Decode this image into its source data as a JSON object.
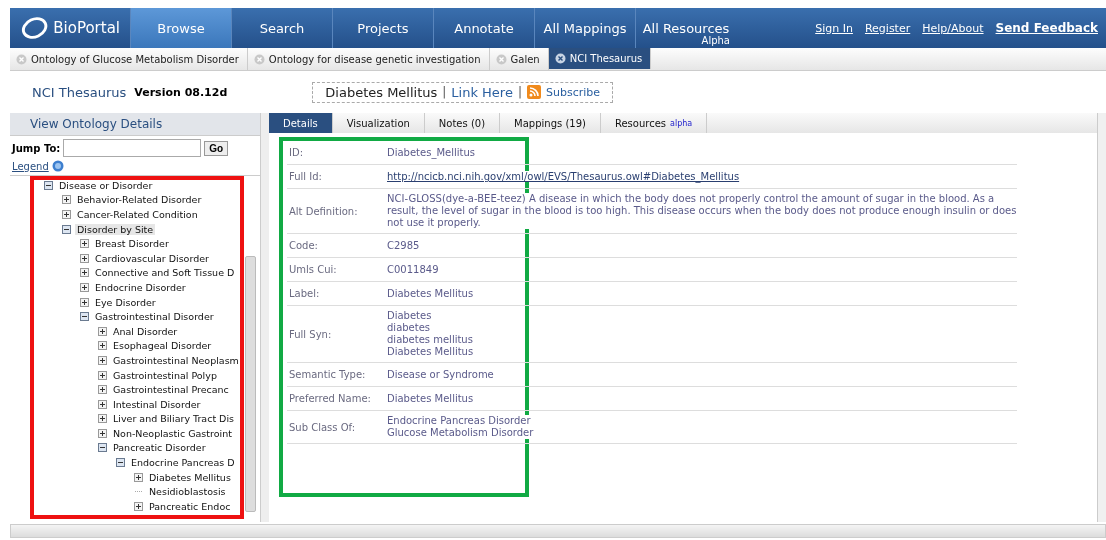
{
  "nav": {
    "logo": "BioPortal",
    "items": [
      {
        "label": "Browse",
        "selected": true
      },
      {
        "label": "Search",
        "selected": false
      },
      {
        "label": "Projects",
        "selected": false
      },
      {
        "label": "Annotate",
        "selected": false
      },
      {
        "label": "All Mappings",
        "selected": false
      },
      {
        "label": "All Resources",
        "sub": "Alpha",
        "selected": false
      }
    ],
    "links": [
      {
        "label": "Sign In",
        "bold": false
      },
      {
        "label": "Register",
        "bold": false
      },
      {
        "label": "Help/About",
        "bold": false
      },
      {
        "label": "Send Feedback",
        "bold": true
      }
    ]
  },
  "ontology_tabs": [
    {
      "label": "Ontology of Glucose Metabolism Disorder",
      "selected": false
    },
    {
      "label": "Ontology for disease genetic investigation",
      "selected": false
    },
    {
      "label": "Galen",
      "selected": false
    },
    {
      "label": "NCI Thesaurus",
      "selected": true
    }
  ],
  "header": {
    "ontology": "NCI Thesaurus",
    "version": "Version 08.12d",
    "term": "Diabetes Mellitus",
    "separator_1": "|",
    "link": "Link Here",
    "separator_2": "|",
    "subscribe": "Subscribe"
  },
  "sidebar": {
    "title": "View Ontology Details",
    "jump_label": "Jump To:",
    "go": "Go",
    "legend": "Legend",
    "tree": [
      {
        "label": "Disease or Disorder",
        "kind": "folder",
        "expanded": true,
        "selected": false,
        "children": [
          {
            "label": "Behavior-Related Disorder",
            "kind": "folder",
            "expanded": false,
            "selected": false
          },
          {
            "label": "Cancer-Related Condition",
            "kind": "folder",
            "expanded": false,
            "selected": false
          },
          {
            "label": "Disorder by Site",
            "kind": "folder",
            "expanded": true,
            "selected": true,
            "children": [
              {
                "label": "Breast Disorder",
                "kind": "folder",
                "expanded": false,
                "selected": false
              },
              {
                "label": "Cardiovascular Disorder",
                "kind": "folder",
                "expanded": false,
                "selected": false
              },
              {
                "label": "Connective and Soft Tissue D",
                "kind": "folder",
                "expanded": false,
                "selected": false
              },
              {
                "label": "Endocrine Disorder",
                "kind": "folder",
                "expanded": false,
                "selected": false
              },
              {
                "label": "Eye Disorder",
                "kind": "folder",
                "expanded": false,
                "selected": false
              },
              {
                "label": "Gastrointestinal Disorder",
                "kind": "folder",
                "expanded": true,
                "selected": false,
                "children": [
                  {
                    "label": "Anal Disorder",
                    "kind": "folder",
                    "expanded": false,
                    "selected": false
                  },
                  {
                    "label": "Esophageal Disorder",
                    "kind": "folder",
                    "expanded": false,
                    "selected": false
                  },
                  {
                    "label": "Gastrointestinal Neoplasm",
                    "kind": "folder",
                    "expanded": false,
                    "selected": false
                  },
                  {
                    "label": "Gastrointestinal Polyp",
                    "kind": "folder",
                    "expanded": false,
                    "selected": false
                  },
                  {
                    "label": "Gastrointestinal Precanc",
                    "kind": "folder",
                    "expanded": false,
                    "selected": false
                  },
                  {
                    "label": "Intestinal Disorder",
                    "kind": "folder",
                    "expanded": false,
                    "selected": false
                  },
                  {
                    "label": "Liver and Biliary Tract Dis",
                    "kind": "folder",
                    "expanded": false,
                    "selected": false
                  },
                  {
                    "label": "Non-Neoplastic Gastroint",
                    "kind": "folder",
                    "expanded": false,
                    "selected": false
                  },
                  {
                    "label": "Pancreatic Disorder",
                    "kind": "folder",
                    "expanded": true,
                    "selected": false,
                    "children": [
                      {
                        "label": "Endocrine Pancreas D",
                        "kind": "folder",
                        "expanded": true,
                        "selected": false,
                        "children": [
                          {
                            "label": "Diabetes Mellitus",
                            "kind": "folder",
                            "expanded": false,
                            "selected": false
                          },
                          {
                            "label": "Nesidioblastosis",
                            "kind": "leaf",
                            "selected": false
                          },
                          {
                            "label": "Pancreatic Endoc",
                            "kind": "folder",
                            "expanded": false,
                            "selected": false
                          }
                        ]
                      }
                    ]
                  }
                ]
              }
            ]
          }
        ]
      }
    ]
  },
  "detail_tabs": [
    {
      "label": "Details",
      "selected": true
    },
    {
      "label": "Visualization",
      "selected": false
    },
    {
      "label": "Notes (0)",
      "selected": false
    },
    {
      "label": "Mappings (19)",
      "selected": false
    },
    {
      "label": "Resources",
      "badge": "alpha",
      "selected": false
    }
  ],
  "details": [
    {
      "label": "ID:",
      "kind": "text",
      "values": [
        "Diabetes_Mellitus"
      ]
    },
    {
      "label": "Full Id:",
      "kind": "link",
      "values": [
        "http://ncicb.nci.nih.gov/xml/owl/EVS/Thesaurus.owl#Diabetes_Mellitus"
      ]
    },
    {
      "label": "Alt Definition:",
      "kind": "text",
      "values": [
        "NCI-GLOSS(dye-a-BEE-teez) A disease in which the body does not properly control the amount of sugar in the blood. As a result, the level of sugar in the blood is too high. This disease occurs when the body does not produce enough insulin or does not use it properly."
      ]
    },
    {
      "label": "Code:",
      "kind": "text",
      "values": [
        "C2985"
      ]
    },
    {
      "label": "Umls Cui:",
      "kind": "text",
      "values": [
        "C0011849"
      ]
    },
    {
      "label": "Label:",
      "kind": "text",
      "values": [
        "Diabetes Mellitus"
      ]
    },
    {
      "label": "Full Syn:",
      "kind": "text",
      "values": [
        "Diabetes",
        "diabetes",
        "diabetes mellitus",
        "Diabetes Mellitus"
      ]
    },
    {
      "label": "Semantic Type:",
      "kind": "text",
      "values": [
        "Disease or Syndrome"
      ]
    },
    {
      "label": "Preferred Name:",
      "kind": "text",
      "values": [
        "Diabetes Mellitus"
      ]
    },
    {
      "label": "Sub Class Of:",
      "kind": "text",
      "values": [
        "Endocrine Pancreas Disorder",
        "Glucose Metabolism Disorder"
      ]
    }
  ],
  "highlights": [
    {
      "color": "#ee1111"
    },
    {
      "color": "#11aa44"
    }
  ]
}
